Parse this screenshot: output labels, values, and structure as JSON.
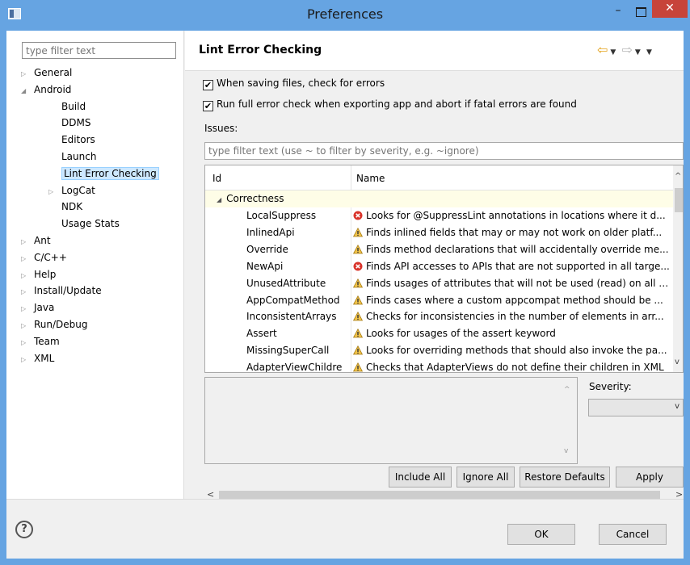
{
  "window": {
    "title": "Preferences",
    "minimize_glyph": "–",
    "close_glyph": "✕"
  },
  "sidebar": {
    "filter_placeholder": "type filter text",
    "items": [
      {
        "label": "General",
        "expander": "▷"
      },
      {
        "label": "Android",
        "expander": "◢"
      },
      {
        "label": "Build"
      },
      {
        "label": "DDMS"
      },
      {
        "label": "Editors"
      },
      {
        "label": "Launch"
      },
      {
        "label": "Lint Error Checking",
        "selected": true
      },
      {
        "label": "LogCat",
        "expander": "▷"
      },
      {
        "label": "NDK"
      },
      {
        "label": "Usage Stats"
      },
      {
        "label": "Ant",
        "expander": "▷"
      },
      {
        "label": "C/C++",
        "expander": "▷"
      },
      {
        "label": "Help",
        "expander": "▷"
      },
      {
        "label": "Install/Update",
        "expander": "▷"
      },
      {
        "label": "Java",
        "expander": "▷"
      },
      {
        "label": "Run/Debug",
        "expander": "▷"
      },
      {
        "label": "Team",
        "expander": "▷"
      },
      {
        "label": "XML",
        "expander": "▷"
      }
    ]
  },
  "page": {
    "title": "Lint Error Checking",
    "nav": {
      "back": "⇦",
      "forward": "⇨",
      "dropdown": "▼"
    },
    "check_on_save": {
      "label": "When saving files, check for errors",
      "checked": true
    },
    "check_on_export": {
      "label": "Run full error check when exporting app and abort if fatal errors are found",
      "checked": true
    },
    "issues_label": "Issues:",
    "issues_filter_placeholder": "type filter text (use ~ to filter by severity, e.g. ~ignore)",
    "table": {
      "columns": [
        "Id",
        "Name"
      ],
      "category": "Correctness",
      "category_arrow": "◢",
      "rows": [
        {
          "id": "LocalSuppress",
          "severity": "error",
          "name": "Looks for @SuppressLint annotations in locations where it d..."
        },
        {
          "id": "InlinedApi",
          "severity": "warning",
          "name": "Finds inlined fields that may or may not work on older platf..."
        },
        {
          "id": "Override",
          "severity": "warning",
          "name": "Finds method declarations that will accidentally override me..."
        },
        {
          "id": "NewApi",
          "severity": "error",
          "name": "Finds API accesses to APIs that are not supported in all targe..."
        },
        {
          "id": "UnusedAttribute",
          "severity": "warning",
          "name": "Finds usages of attributes that will not be used (read) on all t..."
        },
        {
          "id": "AppCompatMethod",
          "severity": "warning",
          "name": "Finds cases where a custom appcompat method should be ..."
        },
        {
          "id": "InconsistentArrays",
          "severity": "warning",
          "name": "Checks for inconsistencies in the number of elements in arr..."
        },
        {
          "id": "Assert",
          "severity": "warning",
          "name": "Looks for usages of the assert keyword"
        },
        {
          "id": "MissingSuperCall",
          "severity": "warning",
          "name": "Looks for overriding methods that should also invoke the pa..."
        },
        {
          "id": "AdapterViewChildre",
          "severity": "warning",
          "name": "Checks that AdapterViews do not define their children in XML"
        }
      ]
    },
    "severity_label": "Severity:",
    "severity_value": "",
    "buttons": {
      "include_all": "Include All",
      "ignore_all": "Ignore All",
      "restore_defaults": "Restore Defaults",
      "apply": "Apply"
    }
  },
  "footer": {
    "help": "?",
    "ok": "OK",
    "cancel": "Cancel"
  },
  "colors": {
    "frame": "#66a4e2",
    "close": "#c7443a",
    "selection": "#cde8ff",
    "category_row": "#fefde7",
    "error": "#d9342b",
    "warning": "#f2c44a"
  },
  "icons": {
    "error": "error-icon",
    "warning": "warning-icon"
  }
}
